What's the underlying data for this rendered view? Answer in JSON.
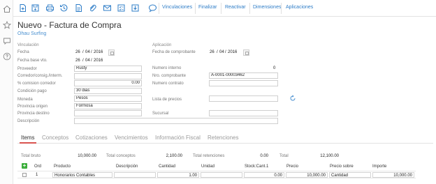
{
  "toolbar": {
    "links": [
      "Vinculaciones",
      "Finalizar",
      "Reactivar",
      "Dimensiones",
      "Aplicaciones"
    ]
  },
  "page": {
    "title": "Nuevo - Factura de Compra",
    "subtitle": "Ohau Surfing"
  },
  "form": {
    "vinculacion_section": "Vinculación",
    "aplicacion_section": "Aplicación",
    "fecha": {
      "label": "Fecha",
      "day": "26",
      "month": "04",
      "year": "2016"
    },
    "fecha_base_vto": {
      "label": "Fecha base vto.",
      "day": "26",
      "month": "04",
      "year": "2016"
    },
    "proveedor": {
      "label": "Proveedor",
      "value": "Rusty"
    },
    "corredor": {
      "label": "Corredor/consig./interm.",
      "value": ""
    },
    "comision": {
      "label": "% comision corredor",
      "value": "0.00"
    },
    "condicion_pago": {
      "label": "Condición pago",
      "value": "30 dias"
    },
    "moneda": {
      "label": "Moneda",
      "value": "Pesos"
    },
    "provincia_origen": {
      "label": "Provincia origen",
      "value": "Formosa"
    },
    "provincia_destino": {
      "label": "Provincia destino",
      "value": ""
    },
    "descripcion": {
      "label": "Descripción",
      "value": ""
    },
    "fecha_comprobante": {
      "label": "Fecha de comprobante",
      "day": "26",
      "month": "04",
      "year": "2016"
    },
    "numero_interno": {
      "label": "Numero interno",
      "value": "0"
    },
    "nro_comprobante": {
      "label": "Nro. comprobante",
      "value": "A-0001-00003462"
    },
    "numero_contrato": {
      "label": "Numero contrato",
      "value": ""
    },
    "lista_precios": {
      "label": "Lista de precios",
      "value": ""
    },
    "sucursal": {
      "label": "Sucursal",
      "value": ""
    }
  },
  "tabs": [
    "Items",
    "Conceptos",
    "Cotizaciones",
    "Vencimientos",
    "Información Fiscal",
    "Retenciones"
  ],
  "totals": {
    "bruto": {
      "label": "Total bruto",
      "value": "10,000.00"
    },
    "conceptos": {
      "label": "Total conceptos",
      "value": "2,100.00"
    },
    "retenciones": {
      "label": "Total retenciones",
      "value": "0.00"
    },
    "total": {
      "label": "Total",
      "value": "12,100.00"
    }
  },
  "grid": {
    "columns": [
      "Ord",
      "Producto",
      "Descripción",
      "Cantidad",
      "Unidad",
      "Stock:Cant.1",
      "Precio",
      "Precio sobre",
      "Importe"
    ],
    "rows": [
      {
        "ord": "1",
        "producto": "Honorarios Contables",
        "descripcion": "",
        "cantidad": "1.00",
        "unidad": "",
        "stock": "0.00",
        "precio": "10,000.00",
        "precio_sobre": "Cantidad",
        "importe": "10,000.00"
      }
    ]
  },
  "colors": {
    "accent": "#2d7cc7",
    "tab_active": "#d9534f",
    "add_button": "#3cae3c"
  }
}
